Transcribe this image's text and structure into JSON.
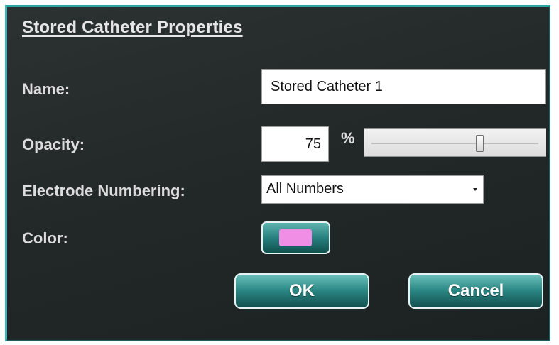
{
  "dialog": {
    "title": "Stored Catheter Properties"
  },
  "fields": {
    "name_label": "Name:",
    "name_value": "Stored Catheter 1",
    "opacity_label": "Opacity:",
    "opacity_value": "75",
    "opacity_unit": "%",
    "opacity_slider_level": 0.65,
    "electrode_label": "Electrode Numbering:",
    "electrode_selected": "All Numbers",
    "color_label": "Color:",
    "color_value": "#f08ee6"
  },
  "buttons": {
    "ok": "OK",
    "cancel": "Cancel"
  },
  "colors": {
    "accent": "#2aa6a8",
    "background": "#252b2b",
    "button_top": "#6ac0ba",
    "button_bottom": "#134f4f"
  },
  "icons": {
    "dropdown": "chevron-down-icon"
  }
}
